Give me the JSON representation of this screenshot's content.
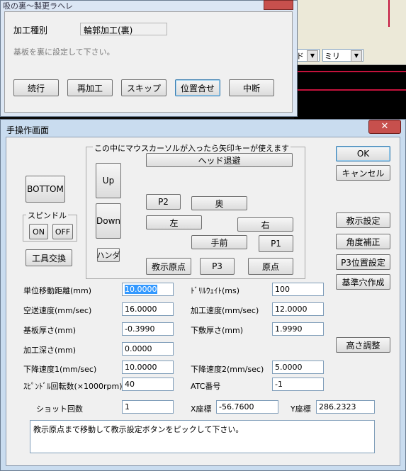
{
  "background_app": {
    "combo_1": "ド",
    "combo_2": "ミリ"
  },
  "dialog1": {
    "title": "吸の裏〜製更ラヘレ",
    "kind_label": "加工種別",
    "kind_value": "輪郭加工(裏)",
    "message": "基板を裏に設定して下さい。",
    "buttons": [
      "続行",
      "再加工",
      "スキップ",
      "位置合せ",
      "中断"
    ]
  },
  "dialog2": {
    "title": "手操作画面",
    "close_glyph": "✕",
    "buttons_right_top": [
      "OK",
      "キャンセル"
    ],
    "buttons_right_mid": [
      "教示設定",
      "角度補正",
      "P3位置設定",
      "基準穴作成"
    ],
    "button_height_adjust": "高さ調整",
    "bottom_button": "BOTTOM",
    "spindle_group": "スピンドル",
    "spindle_on": "ON",
    "spindle_off": "OFF",
    "tool_change": "工具交換",
    "arrow_group": "この中にマウスカーソルが入ったら矢印キーが使えます",
    "head_retract": "ヘッド退避",
    "up": "Up",
    "down": "Down",
    "solder": "ハンダ",
    "p2": "P2",
    "back": "奥",
    "left": "左",
    "right": "右",
    "front": "手前",
    "p1": "P1",
    "teach_origin": "教示原点",
    "p3": "P3",
    "origin": "原点",
    "params_left": [
      {
        "label": "単位移動距離(mm)",
        "value": "10.0000"
      },
      {
        "label": "空送速度(mm/sec)",
        "value": "16.0000"
      },
      {
        "label": "基板厚さ(mm)",
        "value": "-0.3990"
      },
      {
        "label": "加工深さ(mm)",
        "value": "0.0000"
      },
      {
        "label": "下降速度1(mm/sec)",
        "value": "10.0000"
      },
      {
        "label": "ｽﾋﾟﾝﾄﾞﾙ回転数(×1000rpm)",
        "value": "40"
      },
      {
        "label": "ショット回数",
        "value": "1"
      }
    ],
    "params_right": [
      {
        "label": "ﾄﾞﾘﾙｳｪｲﾄ(ms)",
        "value": "100"
      },
      {
        "label": "加工速度(mm/sec)",
        "value": "12.0000"
      },
      {
        "label": "下敷厚さ(mm)",
        "value": "1.9990"
      },
      {
        "label": "下降速度2(mm/sec)",
        "value": "5.0000"
      },
      {
        "label": "ATC番号",
        "value": "-1"
      }
    ],
    "x_label": "X座標",
    "x_value": "-56.7600",
    "y_label": "Y座標",
    "y_value": "286.2323",
    "message": "教示原点まで移動して教示設定ボタンをピックして下さい。"
  }
}
